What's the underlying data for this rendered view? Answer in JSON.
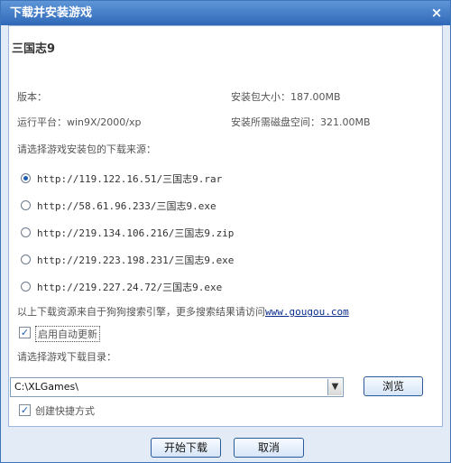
{
  "window": {
    "title": "下载并安装游戏",
    "close_glyph": "×"
  },
  "game": {
    "title": "三国志9",
    "version_label": "版本：",
    "package_size": "安装包大小：187.00MB",
    "platform": "运行平台：win9X/2000/xp",
    "disk_space": "安装所需磁盘空间：321.00MB"
  },
  "source": {
    "prompt": "请选择游戏安装包的下载来源：",
    "options": [
      {
        "url": "http://119.122.16.51/三国志9.rar",
        "checked": true
      },
      {
        "url": "http://58.61.96.233/三国志9.exe",
        "checked": false
      },
      {
        "url": "http://219.134.106.216/三国志9.zip",
        "checked": false
      },
      {
        "url": "http://219.223.198.231/三国志9.exe",
        "checked": false
      },
      {
        "url": "http://219.227.24.72/三国志9.exe",
        "checked": false
      }
    ],
    "note": "以上下载资源来自于狗狗搜索引擎，更多搜索结果请访问",
    "note_link": "www.gougou.com"
  },
  "options": {
    "auto_update_label": "启用自动更新",
    "auto_update_checked": true,
    "dir_prompt": "请选择游戏下载目录：",
    "dir_value": "C:\\XLGames\\",
    "browse_label": "浏览",
    "shortcut_label": "创建快捷方式",
    "shortcut_checked": true
  },
  "footer": {
    "start_label": "开始下载",
    "cancel_label": "取消"
  },
  "icons": {
    "check": "✓",
    "dropdown": "▼"
  }
}
